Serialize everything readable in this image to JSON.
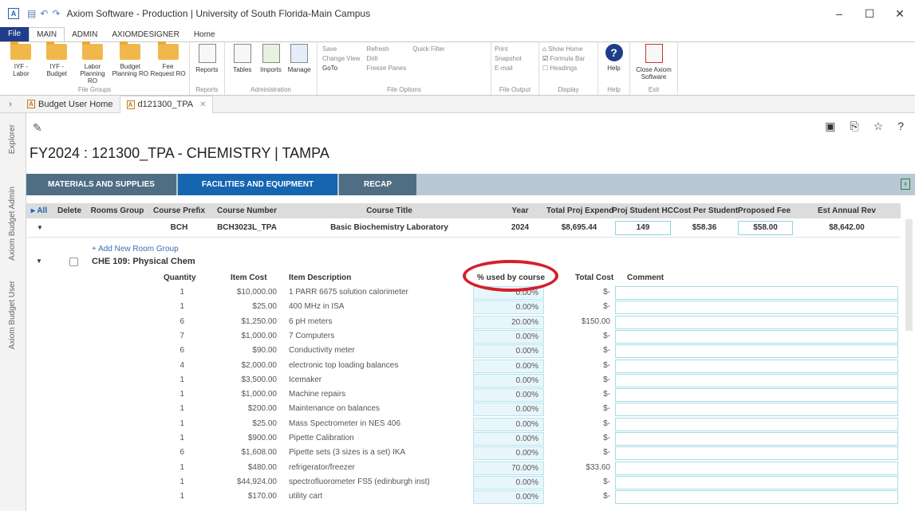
{
  "window": {
    "title": "Axiom Software - Production | University of South Florida-Main Campus",
    "app_icon_letter": "A",
    "controls": [
      "–",
      "☐",
      "✕"
    ]
  },
  "menu": {
    "file": "File",
    "tabs": [
      "MAIN",
      "ADMIN",
      "AXIOMDESIGNER",
      "Home"
    ],
    "active": "MAIN"
  },
  "ribbon": {
    "file_groups_label": "File Groups",
    "file_groups": [
      {
        "line1": "IYF -",
        "line2": "Labor"
      },
      {
        "line1": "IYF -",
        "line2": "Budget"
      },
      {
        "line1": "Labor",
        "line2": "Planning RO"
      },
      {
        "line1": "Budget",
        "line2": "Planning RO"
      },
      {
        "line1": "Fee",
        "line2": "Request RO"
      }
    ],
    "reports_group_label": "Reports",
    "reports_button": "Reports",
    "admin_group_label": "Administration",
    "admin_buttons": [
      "Tables",
      "Imports",
      "Manage"
    ],
    "file_options_label": "File Options",
    "file_options_col1": [
      "Save",
      "Change View",
      "GoTo"
    ],
    "file_options_col2": [
      "Refresh",
      "Drill",
      "Freeze Panes"
    ],
    "quick_filter": "Quick Filter",
    "file_output_label": "File Output",
    "file_output": [
      "Print",
      "Snapshot",
      "E-mail"
    ],
    "display_label": "Display",
    "display": [
      "Show Home",
      "Formula Bar",
      "Headings"
    ],
    "help_group_label": "Help",
    "help_button": "Help",
    "exit_group_label": "Exit",
    "close_line1": "Close Axiom",
    "close_line2": "Software"
  },
  "doc_tabs": [
    {
      "label": "Budget User Home",
      "active": false
    },
    {
      "label": "d121300_TPA",
      "active": true
    }
  ],
  "sidebar": {
    "tabs": [
      "Explorer",
      "Axiom Budget Admin",
      "Axiom Budget User"
    ]
  },
  "page": {
    "title": "FY2024 : 121300_TPA - CHEMISTRY | TAMPA",
    "sections": [
      {
        "label": "MATERIALS AND SUPPLIES",
        "color": "#4f6e83"
      },
      {
        "label": "FACILITIES AND EQUIPMENT",
        "color": "#1565b0"
      },
      {
        "label": "RECAP",
        "color": "#4f6e83"
      }
    ]
  },
  "grid": {
    "headers": [
      "▸ All",
      "Delete",
      "Rooms Group",
      "Course Prefix",
      "Course Number",
      "Course Title",
      "Year",
      "Total Proj Expend",
      "Proj Student HC",
      "Cost Per Student",
      "Proposed Fee",
      "Est Annual Rev"
    ],
    "row": {
      "prefix": "BCH",
      "number": "BCH3023L_TPA",
      "title": "Basic Biochemistry Laboratory",
      "year": "2024",
      "total_proj_expend": "$8,695.44",
      "proj_student_hc": "149",
      "cost_per_student": "$58.36",
      "proposed_fee": "$58.00",
      "est_annual_rev": "$8,642.00"
    },
    "add_room_group": "+ Add New Room Group",
    "room_group": "CHE 109: Physical Chem",
    "item_headers": [
      "Quantity",
      "Item Cost",
      "Item Description",
      "% used by course",
      "Total Cost",
      "Comment"
    ],
    "items": [
      {
        "qty": "1",
        "cost": "$10,000.00",
        "desc": "1 PARR 6675 solution calorimeter",
        "pct": "0.00%",
        "total": "$-"
      },
      {
        "qty": "1",
        "cost": "$25.00",
        "desc": "400 MHz in ISA",
        "pct": "0.00%",
        "total": "$-"
      },
      {
        "qty": "6",
        "cost": "$1,250.00",
        "desc": "6 pH meters",
        "pct": "20.00%",
        "total": "$150.00"
      },
      {
        "qty": "7",
        "cost": "$1,000.00",
        "desc": "7 Computers",
        "pct": "0.00%",
        "total": "$-"
      },
      {
        "qty": "6",
        "cost": "$90.00",
        "desc": "Conductivity meter",
        "pct": "0.00%",
        "total": "$-"
      },
      {
        "qty": "4",
        "cost": "$2,000.00",
        "desc": "electronic top loading balances",
        "pct": "0.00%",
        "total": "$-"
      },
      {
        "qty": "1",
        "cost": "$3,500.00",
        "desc": "Icemaker",
        "pct": "0.00%",
        "total": "$-"
      },
      {
        "qty": "1",
        "cost": "$1,000.00",
        "desc": "Machine repairs",
        "pct": "0.00%",
        "total": "$-"
      },
      {
        "qty": "1",
        "cost": "$200.00",
        "desc": "Maintenance on balances",
        "pct": "0.00%",
        "total": "$-"
      },
      {
        "qty": "1",
        "cost": "$25.00",
        "desc": "Mass Spectrometer in NES 406",
        "pct": "0.00%",
        "total": "$-"
      },
      {
        "qty": "1",
        "cost": "$900.00",
        "desc": "Pipette Calibration",
        "pct": "0.00%",
        "total": "$-"
      },
      {
        "qty": "6",
        "cost": "$1,608.00",
        "desc": "Pipette sets (3 sizes is a set) IKA",
        "pct": "0.00%",
        "total": "$-"
      },
      {
        "qty": "1",
        "cost": "$480.00",
        "desc": "refrigerator/freezer",
        "pct": "70.00%",
        "total": "$33.60"
      },
      {
        "qty": "1",
        "cost": "$44,924.00",
        "desc": "spectrofluorometer FS5 (edinburgh inst)",
        "pct": "0.00%",
        "total": "$-"
      },
      {
        "qty": "1",
        "cost": "$170.00",
        "desc": "utility cart",
        "pct": "0.00%",
        "total": "$-"
      }
    ]
  },
  "annotation_color": "#d4202a"
}
